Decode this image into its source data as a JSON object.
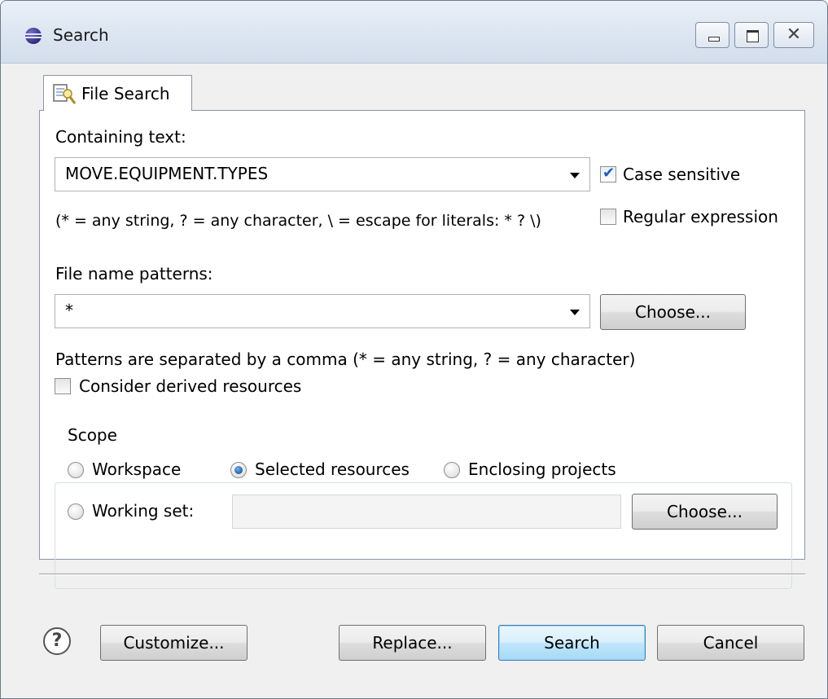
{
  "window": {
    "title": "Search"
  },
  "tab": {
    "label": "File Search"
  },
  "containing_text": {
    "label": "Containing text:",
    "value": "MOVE.EQUIPMENT.TYPES",
    "hint": "(* = any string, ? = any character, \\ = escape for literals: * ? \\)"
  },
  "options": {
    "case_sensitive": {
      "label": "Case sensitive",
      "checked": true
    },
    "regular_expression": {
      "label": "Regular expression",
      "checked": false
    }
  },
  "file_patterns": {
    "label": "File name patterns:",
    "value": "*",
    "choose_label": "Choose...",
    "hint": "Patterns are separated by a comma (* = any string, ? = any character)"
  },
  "derived": {
    "label": "Consider derived resources",
    "checked": false
  },
  "scope": {
    "title": "Scope",
    "workspace": "Workspace",
    "selected_resources": "Selected resources",
    "enclosing_projects": "Enclosing projects",
    "working_set": "Working set:",
    "selected": "selected_resources",
    "choose_label": "Choose..."
  },
  "footer": {
    "help_glyph": "?",
    "customize": "Customize...",
    "replace": "Replace...",
    "search": "Search",
    "cancel": "Cancel"
  },
  "icons": {
    "app": "eclipse-icon",
    "tab": "file-search-icon",
    "minimize": "minimize-icon",
    "maximize": "maximize-icon",
    "close": "close-icon",
    "help": "help-icon"
  }
}
